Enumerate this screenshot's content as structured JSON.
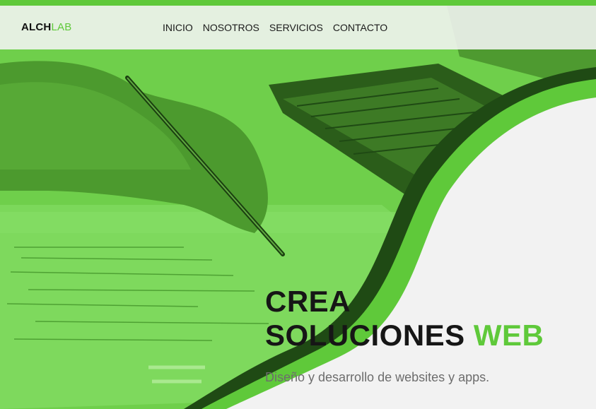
{
  "brand": {
    "logo_part1": "ALCH",
    "logo_part2": "LAB"
  },
  "nav": {
    "items": [
      {
        "label": "INICIO"
      },
      {
        "label": "NOSOTROS"
      },
      {
        "label": "SERVICIOS"
      },
      {
        "label": "CONTACTO"
      }
    ]
  },
  "hero": {
    "headline_line1": "CREA",
    "headline_line2_a": "SOLUCIONES",
    "headline_line2_b": "WEB",
    "subtitle": "Diseño y desarrollo de websites y apps."
  },
  "colors": {
    "accent": "#5fc93a",
    "dark_green": "#1f4a14",
    "panel": "#f2f2f2"
  },
  "image": {
    "description_icon": "desk-photo-hand-pen-laptop"
  }
}
